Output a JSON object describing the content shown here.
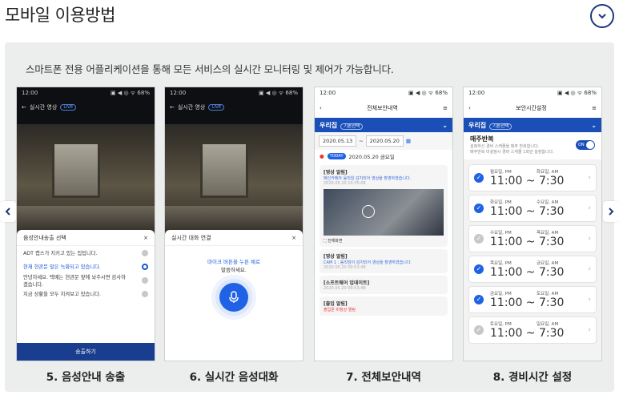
{
  "header": {
    "title": "모바일 이용방법"
  },
  "intro": "스마트폰 전용 어플리케이션을 통해 모든 서비스의 실시간 모니터링 및 제어가 가능합니다.",
  "captions": [
    "5. 음성안내 송출",
    "6. 실시간 음성대화",
    "7. 전체보안내역",
    "8. 경비시간 설정"
  ],
  "colors": {
    "accent": "#1a4fb8",
    "navy": "#193d8f"
  },
  "screen5": {
    "status_time": "12:00",
    "status_icons": "▣ ◀ ◎ ᯤ 68%",
    "title": "실시간 영상",
    "live": "LIVE",
    "sheet_title": "음성안내송출 선택",
    "options": [
      {
        "label": "ADT 캡스가 지키고 있는 집입니다.",
        "selected": false
      },
      {
        "label": "현재 현관문 앞은 녹화되고 있습니다.",
        "selected": true
      },
      {
        "label": "안녕하세요. 택배는 현관문 앞에 놔주시면 감사하겠습니다.",
        "selected": false
      },
      {
        "label": "지금 상황을 모두 지켜보고 있습니다.",
        "selected": false
      }
    ],
    "cta": "송출하기"
  },
  "screen6": {
    "status_time": "12:00",
    "title": "실시간 영상",
    "live": "LIVE",
    "sheet_title": "실시간 대화 연결",
    "hint_blue": "마이크 버튼을 누른 채로",
    "hint": "말씀하세요."
  },
  "screen7": {
    "status_time": "12:00",
    "title": "전체보안내역",
    "home": "우리집",
    "home_tag": "기본선택",
    "date_from": "2020.05.13",
    "date_to": "2020.05.20",
    "today_badge": "TODAY",
    "today_date": "2020.05.20 금요일",
    "entries": [
      {
        "title": "[영상 알림]",
        "sub": "메인카메라 움직임 감지되어 영상을 촬영하였습니다.",
        "date": "2020.05.20 10:35:08"
      },
      {
        "title": "[영상 알림]",
        "sub": "CAM 1 : 움직임이 감지되어 영상을 촬영하였습니다.",
        "date": "2020.05.20 09:53:48"
      },
      {
        "title": "[소프트웨어 업데이트]",
        "sub": "",
        "date": "2020.05.20 09:53:48"
      },
      {
        "title": "[출입 알림]",
        "sub": "출입문 비정상 열림",
        "date": ""
      }
    ],
    "fullscreen": "전체화면"
  },
  "screen8": {
    "status_time": "12:00",
    "title": "보안시간설정",
    "home": "우리집",
    "home_tag": "기본선택",
    "repeat_title": "매주반복",
    "repeat_desc1": "설정하신 경비 스케줄을 매주 반복합니다.",
    "repeat_desc2": "매주반복 미설정시 경비 스케줄 1회만 설정합니다.",
    "toggle": "ON",
    "schedules": [
      {
        "day1": "월요일, PM",
        "day2": "화요일, AM",
        "from": "11:00",
        "to": "7:30",
        "on": true
      },
      {
        "day1": "화요일, PM",
        "day2": "수요일, AM",
        "from": "11:00",
        "to": "7:30",
        "on": true
      },
      {
        "day1": "수요일, PM",
        "day2": "목요일, AM",
        "from": "11:00",
        "to": "7:30",
        "on": false
      },
      {
        "day1": "목요일, PM",
        "day2": "금요일, AM",
        "from": "11:00",
        "to": "7:30",
        "on": true
      },
      {
        "day1": "금요일, PM",
        "day2": "토요일, AM",
        "from": "11:00",
        "to": "7:30",
        "on": true
      },
      {
        "day1": "토요일, PM",
        "day2": "일요일, AM",
        "from": "11:00",
        "to": "7:30",
        "on": false
      }
    ]
  }
}
